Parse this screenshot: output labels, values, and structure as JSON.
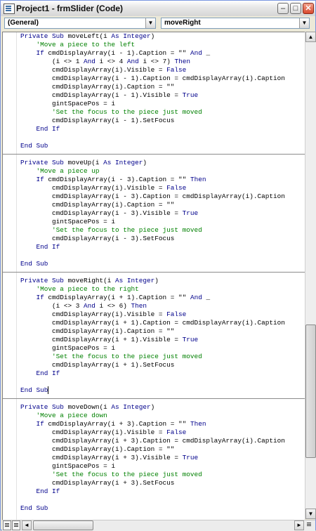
{
  "window": {
    "title": "Project1 - frmSlider (Code)",
    "controls": {
      "minimize": "–",
      "maximize": "□",
      "close": "✕"
    }
  },
  "toolbar": {
    "object_combo": "(General)",
    "procedure_combo": "moveRight"
  },
  "code_procedures": [
    {
      "name": "moveLeft",
      "lines": [
        [
          {
            "t": "Private Sub",
            "k": "kw"
          },
          {
            "t": " moveLeft(i "
          },
          {
            "t": "As Integer",
            "k": "kw"
          },
          {
            "t": ")"
          }
        ],
        [
          {
            "t": "    'Move a piece to the left",
            "k": "cm"
          }
        ],
        [
          {
            "t": "    "
          },
          {
            "t": "If",
            "k": "kw"
          },
          {
            "t": " cmdDisplayArray(i - 1).Caption = \"\" "
          },
          {
            "t": "And",
            "k": "kw"
          },
          {
            "t": " _"
          }
        ],
        [
          {
            "t": "        (i <> 1 "
          },
          {
            "t": "And",
            "k": "kw"
          },
          {
            "t": " i <> 4 "
          },
          {
            "t": "And",
            "k": "kw"
          },
          {
            "t": " i <> 7) "
          },
          {
            "t": "Then",
            "k": "kw"
          }
        ],
        [
          {
            "t": "        cmdDisplayArray(i).Visible = "
          },
          {
            "t": "False",
            "k": "kw"
          }
        ],
        [
          {
            "t": "        cmdDisplayArray(i - 1).Caption = cmdDisplayArray(i).Caption"
          }
        ],
        [
          {
            "t": "        cmdDisplayArray(i).Caption = \"\""
          }
        ],
        [
          {
            "t": "        cmdDisplayArray(i - 1).Visible = "
          },
          {
            "t": "True",
            "k": "kw"
          }
        ],
        [
          {
            "t": "        gintSpacePos = i"
          }
        ],
        [
          {
            "t": "        'Set the focus to the piece just moved",
            "k": "cm"
          }
        ],
        [
          {
            "t": "        cmdDisplayArray(i - 1).SetFocus"
          }
        ],
        [
          {
            "t": "    "
          },
          {
            "t": "End If",
            "k": "kw"
          }
        ],
        [
          {
            "t": ""
          }
        ],
        [
          {
            "t": "End Sub",
            "k": "kw"
          }
        ]
      ]
    },
    {
      "name": "moveUp",
      "lines": [
        [
          {
            "t": "Private Sub",
            "k": "kw"
          },
          {
            "t": " moveUp(i "
          },
          {
            "t": "As Integer",
            "k": "kw"
          },
          {
            "t": ")"
          }
        ],
        [
          {
            "t": "    'Move a piece up",
            "k": "cm"
          }
        ],
        [
          {
            "t": "    "
          },
          {
            "t": "If",
            "k": "kw"
          },
          {
            "t": " cmdDisplayArray(i - 3).Caption = \"\" "
          },
          {
            "t": "Then",
            "k": "kw"
          }
        ],
        [
          {
            "t": "        cmdDisplayArray(i).Visible = "
          },
          {
            "t": "False",
            "k": "kw"
          }
        ],
        [
          {
            "t": "        cmdDisplayArray(i - 3).Caption = cmdDisplayArray(i).Caption"
          }
        ],
        [
          {
            "t": "        cmdDisplayArray(i).Caption = \"\""
          }
        ],
        [
          {
            "t": "        cmdDisplayArray(i - 3).Visible = "
          },
          {
            "t": "True",
            "k": "kw"
          }
        ],
        [
          {
            "t": "        gintSpacePos = i"
          }
        ],
        [
          {
            "t": "        'Set the focus to the piece just moved",
            "k": "cm"
          }
        ],
        [
          {
            "t": "        cmdDisplayArray(i - 3).SetFocus"
          }
        ],
        [
          {
            "t": "    "
          },
          {
            "t": "End If",
            "k": "kw"
          }
        ],
        [
          {
            "t": ""
          }
        ],
        [
          {
            "t": "End Sub",
            "k": "kw"
          }
        ]
      ]
    },
    {
      "name": "moveRight",
      "lines": [
        [
          {
            "t": "Private Sub",
            "k": "kw"
          },
          {
            "t": " moveRight(i "
          },
          {
            "t": "As Integer",
            "k": "kw"
          },
          {
            "t": ")"
          }
        ],
        [
          {
            "t": "    'Move a piece to the right",
            "k": "cm"
          }
        ],
        [
          {
            "t": "    "
          },
          {
            "t": "If",
            "k": "kw"
          },
          {
            "t": " cmdDisplayArray(i + 1).Caption = \"\" "
          },
          {
            "t": "And",
            "k": "kw"
          },
          {
            "t": " _"
          }
        ],
        [
          {
            "t": "        (i <> 3 "
          },
          {
            "t": "And",
            "k": "kw"
          },
          {
            "t": " i <> 6) "
          },
          {
            "t": "Then",
            "k": "kw"
          }
        ],
        [
          {
            "t": "        cmdDisplayArray(i).Visible = "
          },
          {
            "t": "False",
            "k": "kw"
          }
        ],
        [
          {
            "t": "        cmdDisplayArray(i + 1).Caption = cmdDisplayArray(i).Caption"
          }
        ],
        [
          {
            "t": "        cmdDisplayArray(i).Caption = \"\""
          }
        ],
        [
          {
            "t": "        cmdDisplayArray(i + 1).Visible = "
          },
          {
            "t": "True",
            "k": "kw"
          }
        ],
        [
          {
            "t": "        gintSpacePos = i"
          }
        ],
        [
          {
            "t": "        'Set the focus to the piece just moved",
            "k": "cm"
          }
        ],
        [
          {
            "t": "        cmdDisplayArray(i + 1).SetFocus"
          }
        ],
        [
          {
            "t": "    "
          },
          {
            "t": "End If",
            "k": "kw"
          }
        ],
        [
          {
            "t": ""
          }
        ],
        [
          {
            "t": "End Sub",
            "k": "kw"
          },
          {
            "caret": true
          }
        ]
      ]
    },
    {
      "name": "moveDown",
      "lines": [
        [
          {
            "t": "Private Sub",
            "k": "kw"
          },
          {
            "t": " moveDown(i "
          },
          {
            "t": "As Integer",
            "k": "kw"
          },
          {
            "t": ")"
          }
        ],
        [
          {
            "t": "    'Move a piece down",
            "k": "cm"
          }
        ],
        [
          {
            "t": "    "
          },
          {
            "t": "If",
            "k": "kw"
          },
          {
            "t": " cmdDisplayArray(i + 3).Caption = \"\" "
          },
          {
            "t": "Then",
            "k": "kw"
          }
        ],
        [
          {
            "t": "        cmdDisplayArray(i).Visible = "
          },
          {
            "t": "False",
            "k": "kw"
          }
        ],
        [
          {
            "t": "        cmdDisplayArray(i + 3).Caption = cmdDisplayArray(i).Caption"
          }
        ],
        [
          {
            "t": "        cmdDisplayArray(i).Caption = \"\""
          }
        ],
        [
          {
            "t": "        cmdDisplayArray(i + 3).Visible = "
          },
          {
            "t": "True",
            "k": "kw"
          }
        ],
        [
          {
            "t": "        gintSpacePos = i"
          }
        ],
        [
          {
            "t": "        'Set the focus to the piece just moved",
            "k": "cm"
          }
        ],
        [
          {
            "t": "        cmdDisplayArray(i + 3).SetFocus"
          }
        ],
        [
          {
            "t": "    "
          },
          {
            "t": "End If",
            "k": "kw"
          }
        ],
        [
          {
            "t": ""
          }
        ],
        [
          {
            "t": "End Sub",
            "k": "kw"
          }
        ]
      ]
    }
  ],
  "scroll_icons": {
    "up": "▲",
    "down": "▼",
    "left": "◄",
    "right": "►",
    "combo": "▼"
  }
}
